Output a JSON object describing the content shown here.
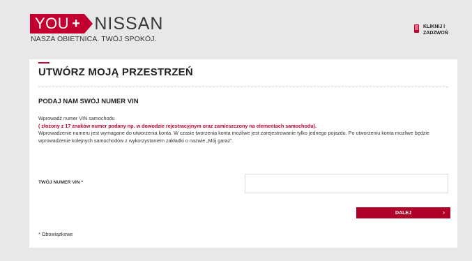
{
  "header": {
    "logo_you": "YOU",
    "logo_plus": "+",
    "logo_brand": "NISSAN",
    "tagline": "NASZA OBIETNICA. TWÓJ SPOKÓJ.",
    "call_line1": "KLIKNIJ I",
    "call_line2": "ZADZWOŃ"
  },
  "main": {
    "title": "UTWÓRZ MOJĄ PRZESTRZEŃ",
    "subtitle": "PODAJ NAM SWÓJ NUMER VIN",
    "desc_line1": "Wprowadź numer VIN samochodu",
    "desc_line2": "( złożony z 17 znaków numer podany np. w dowodzie rejestracyjnym oraz zamieszczony na elementach samochodu).",
    "desc_line3": "Wprowadzenie numeru jest wymagane do utworzenia konta. W czasie tworzenia konta możliwe jest zarejestrowanie tylko jednego pojazdu. Po utworzeniu konta możliwe będzie wprowadzenie kolejnych samochodów z wykorzystaniem zakładki o nazwie „Mój garaż”.",
    "vin_label": "TWÓJ NUMER VIN *",
    "vin_value": "",
    "button_label": "DALEJ",
    "button_chevron": "›",
    "required_note": "* Obowiązkowe"
  },
  "colors": {
    "brand_red": "#c3002f",
    "button_red": "#b0002a"
  },
  "icons": {
    "call": "phone-icon",
    "next": "chevron-right-icon"
  }
}
